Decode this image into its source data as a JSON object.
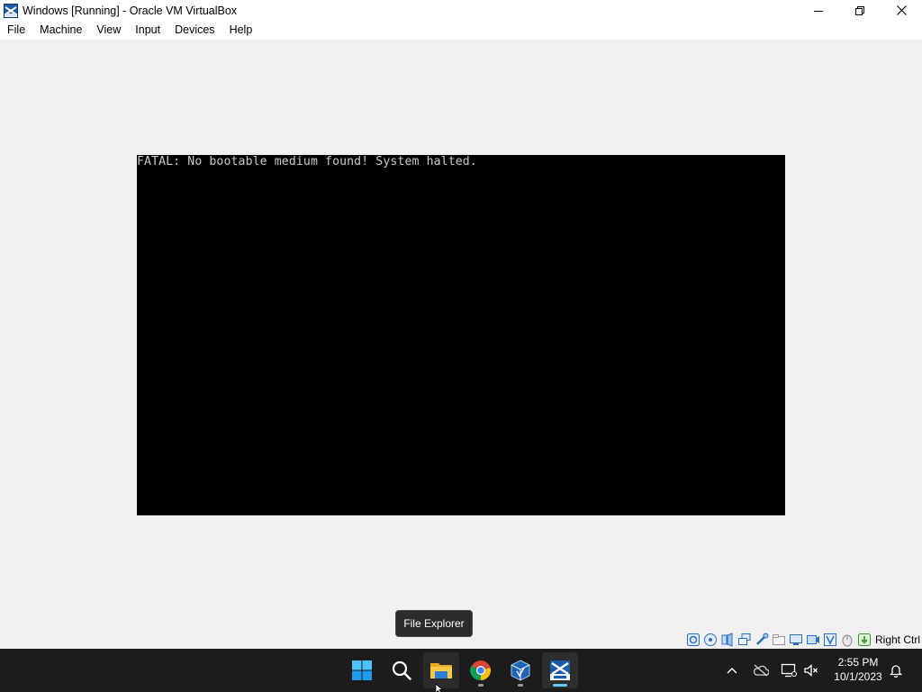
{
  "window": {
    "title": "Windows [Running] - Oracle VM VirtualBox",
    "controls": [
      "minimize-icon",
      "restore-icon",
      "close-icon"
    ]
  },
  "menubar": {
    "items": [
      "File",
      "Machine",
      "View",
      "Input",
      "Devices",
      "Help"
    ]
  },
  "vm": {
    "console_text": "FATAL: No bootable medium found! System halted."
  },
  "tooltip": {
    "text": "File Explorer"
  },
  "statusbar": {
    "icons": [
      "hard-disk-icon",
      "optical-drive-icon",
      "audio-icon",
      "network-icon",
      "usb-icon",
      "shared-folders-icon",
      "display-icon",
      "recording-icon",
      "cpu-virtualization-icon",
      "mouse-integration-icon",
      "keyboard-capture-icon"
    ],
    "host_key": "Right Ctrl"
  },
  "taskbar": {
    "apps": [
      "start-icon",
      "search-icon",
      "file-explorer-icon",
      "chrome-icon",
      "virtualbox-icon",
      "vm-window-icon"
    ],
    "tray": [
      "show-hidden-icons-icon",
      "onedrive-icon",
      "network-icon",
      "volume-muted-icon",
      "notification-icon"
    ],
    "clock": {
      "time": "2:55 PM",
      "date": "10/1/2023"
    }
  },
  "colors": {
    "accent": "#60cdff",
    "taskbar_bg": "#1c1c1c",
    "vm_text": "#c8c8c8"
  }
}
